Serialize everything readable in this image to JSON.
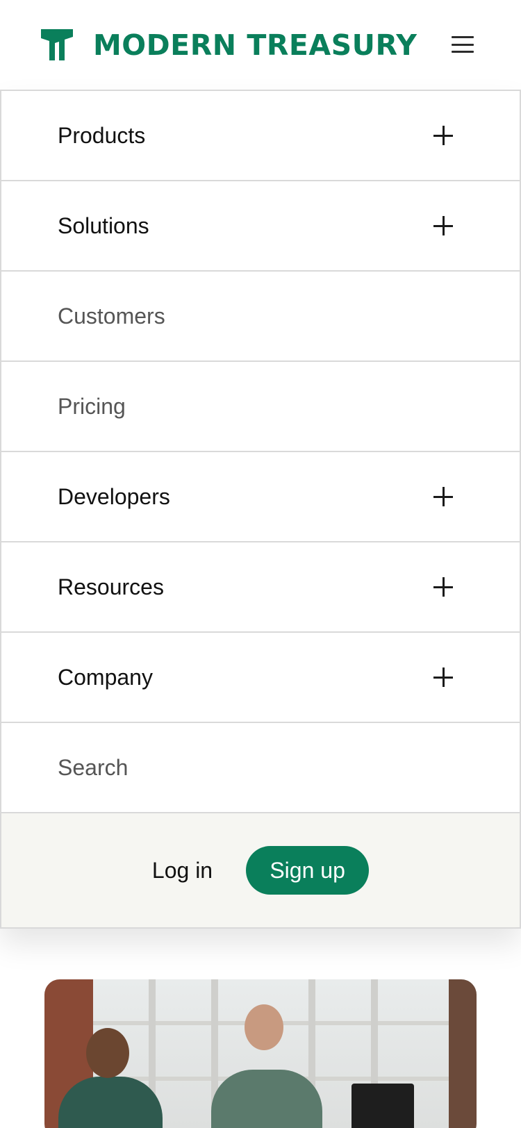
{
  "header": {
    "brand_name": "MODERN TREASURY",
    "logo_icon": "modern-treasury-logo-icon",
    "menu_icon": "hamburger-menu-icon",
    "brand_color": "#0a7f5b"
  },
  "nav": {
    "items": [
      {
        "label": "Products",
        "expandable": true
      },
      {
        "label": "Solutions",
        "expandable": true
      },
      {
        "label": "Customers",
        "expandable": false
      },
      {
        "label": "Pricing",
        "expandable": false
      },
      {
        "label": "Developers",
        "expandable": true
      },
      {
        "label": "Resources",
        "expandable": true
      },
      {
        "label": "Company",
        "expandable": true
      },
      {
        "label": "Search",
        "expandable": false
      }
    ],
    "expand_icon": "plus-icon"
  },
  "auth": {
    "login_label": "Log in",
    "signup_label": "Sign up"
  },
  "colors": {
    "accent": "#0a7f5b",
    "auth_bar_bg": "#f6f6f2",
    "divider": "#d9d9d9"
  }
}
